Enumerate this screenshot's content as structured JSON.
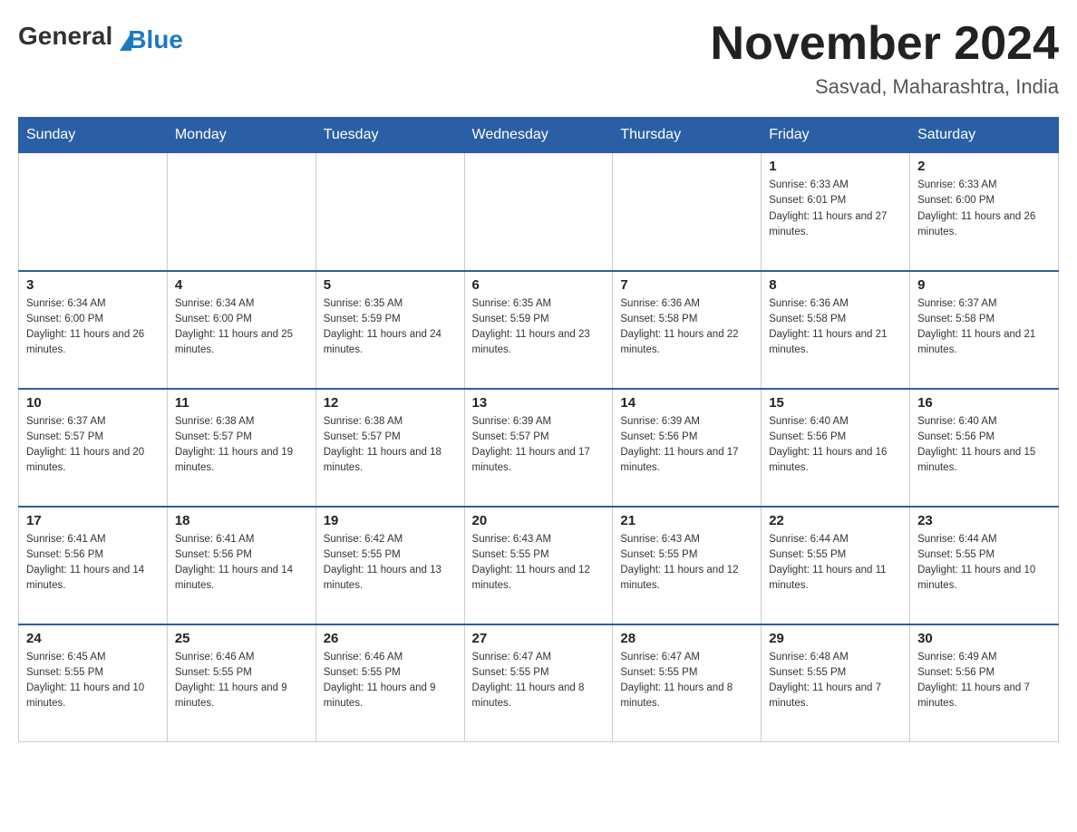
{
  "header": {
    "logo": {
      "general": "General",
      "blue": "Blue"
    },
    "title": "November 2024",
    "location": "Sasvad, Maharashtra, India"
  },
  "days_of_week": [
    "Sunday",
    "Monday",
    "Tuesday",
    "Wednesday",
    "Thursday",
    "Friday",
    "Saturday"
  ],
  "weeks": [
    [
      {
        "day": "",
        "info": ""
      },
      {
        "day": "",
        "info": ""
      },
      {
        "day": "",
        "info": ""
      },
      {
        "day": "",
        "info": ""
      },
      {
        "day": "",
        "info": ""
      },
      {
        "day": "1",
        "info": "Sunrise: 6:33 AM\nSunset: 6:01 PM\nDaylight: 11 hours and 27 minutes."
      },
      {
        "day": "2",
        "info": "Sunrise: 6:33 AM\nSunset: 6:00 PM\nDaylight: 11 hours and 26 minutes."
      }
    ],
    [
      {
        "day": "3",
        "info": "Sunrise: 6:34 AM\nSunset: 6:00 PM\nDaylight: 11 hours and 26 minutes."
      },
      {
        "day": "4",
        "info": "Sunrise: 6:34 AM\nSunset: 6:00 PM\nDaylight: 11 hours and 25 minutes."
      },
      {
        "day": "5",
        "info": "Sunrise: 6:35 AM\nSunset: 5:59 PM\nDaylight: 11 hours and 24 minutes."
      },
      {
        "day": "6",
        "info": "Sunrise: 6:35 AM\nSunset: 5:59 PM\nDaylight: 11 hours and 23 minutes."
      },
      {
        "day": "7",
        "info": "Sunrise: 6:36 AM\nSunset: 5:58 PM\nDaylight: 11 hours and 22 minutes."
      },
      {
        "day": "8",
        "info": "Sunrise: 6:36 AM\nSunset: 5:58 PM\nDaylight: 11 hours and 21 minutes."
      },
      {
        "day": "9",
        "info": "Sunrise: 6:37 AM\nSunset: 5:58 PM\nDaylight: 11 hours and 21 minutes."
      }
    ],
    [
      {
        "day": "10",
        "info": "Sunrise: 6:37 AM\nSunset: 5:57 PM\nDaylight: 11 hours and 20 minutes."
      },
      {
        "day": "11",
        "info": "Sunrise: 6:38 AM\nSunset: 5:57 PM\nDaylight: 11 hours and 19 minutes."
      },
      {
        "day": "12",
        "info": "Sunrise: 6:38 AM\nSunset: 5:57 PM\nDaylight: 11 hours and 18 minutes."
      },
      {
        "day": "13",
        "info": "Sunrise: 6:39 AM\nSunset: 5:57 PM\nDaylight: 11 hours and 17 minutes."
      },
      {
        "day": "14",
        "info": "Sunrise: 6:39 AM\nSunset: 5:56 PM\nDaylight: 11 hours and 17 minutes."
      },
      {
        "day": "15",
        "info": "Sunrise: 6:40 AM\nSunset: 5:56 PM\nDaylight: 11 hours and 16 minutes."
      },
      {
        "day": "16",
        "info": "Sunrise: 6:40 AM\nSunset: 5:56 PM\nDaylight: 11 hours and 15 minutes."
      }
    ],
    [
      {
        "day": "17",
        "info": "Sunrise: 6:41 AM\nSunset: 5:56 PM\nDaylight: 11 hours and 14 minutes."
      },
      {
        "day": "18",
        "info": "Sunrise: 6:41 AM\nSunset: 5:56 PM\nDaylight: 11 hours and 14 minutes."
      },
      {
        "day": "19",
        "info": "Sunrise: 6:42 AM\nSunset: 5:55 PM\nDaylight: 11 hours and 13 minutes."
      },
      {
        "day": "20",
        "info": "Sunrise: 6:43 AM\nSunset: 5:55 PM\nDaylight: 11 hours and 12 minutes."
      },
      {
        "day": "21",
        "info": "Sunrise: 6:43 AM\nSunset: 5:55 PM\nDaylight: 11 hours and 12 minutes."
      },
      {
        "day": "22",
        "info": "Sunrise: 6:44 AM\nSunset: 5:55 PM\nDaylight: 11 hours and 11 minutes."
      },
      {
        "day": "23",
        "info": "Sunrise: 6:44 AM\nSunset: 5:55 PM\nDaylight: 11 hours and 10 minutes."
      }
    ],
    [
      {
        "day": "24",
        "info": "Sunrise: 6:45 AM\nSunset: 5:55 PM\nDaylight: 11 hours and 10 minutes."
      },
      {
        "day": "25",
        "info": "Sunrise: 6:46 AM\nSunset: 5:55 PM\nDaylight: 11 hours and 9 minutes."
      },
      {
        "day": "26",
        "info": "Sunrise: 6:46 AM\nSunset: 5:55 PM\nDaylight: 11 hours and 9 minutes."
      },
      {
        "day": "27",
        "info": "Sunrise: 6:47 AM\nSunset: 5:55 PM\nDaylight: 11 hours and 8 minutes."
      },
      {
        "day": "28",
        "info": "Sunrise: 6:47 AM\nSunset: 5:55 PM\nDaylight: 11 hours and 8 minutes."
      },
      {
        "day": "29",
        "info": "Sunrise: 6:48 AM\nSunset: 5:55 PM\nDaylight: 11 hours and 7 minutes."
      },
      {
        "day": "30",
        "info": "Sunrise: 6:49 AM\nSunset: 5:56 PM\nDaylight: 11 hours and 7 minutes."
      }
    ]
  ]
}
